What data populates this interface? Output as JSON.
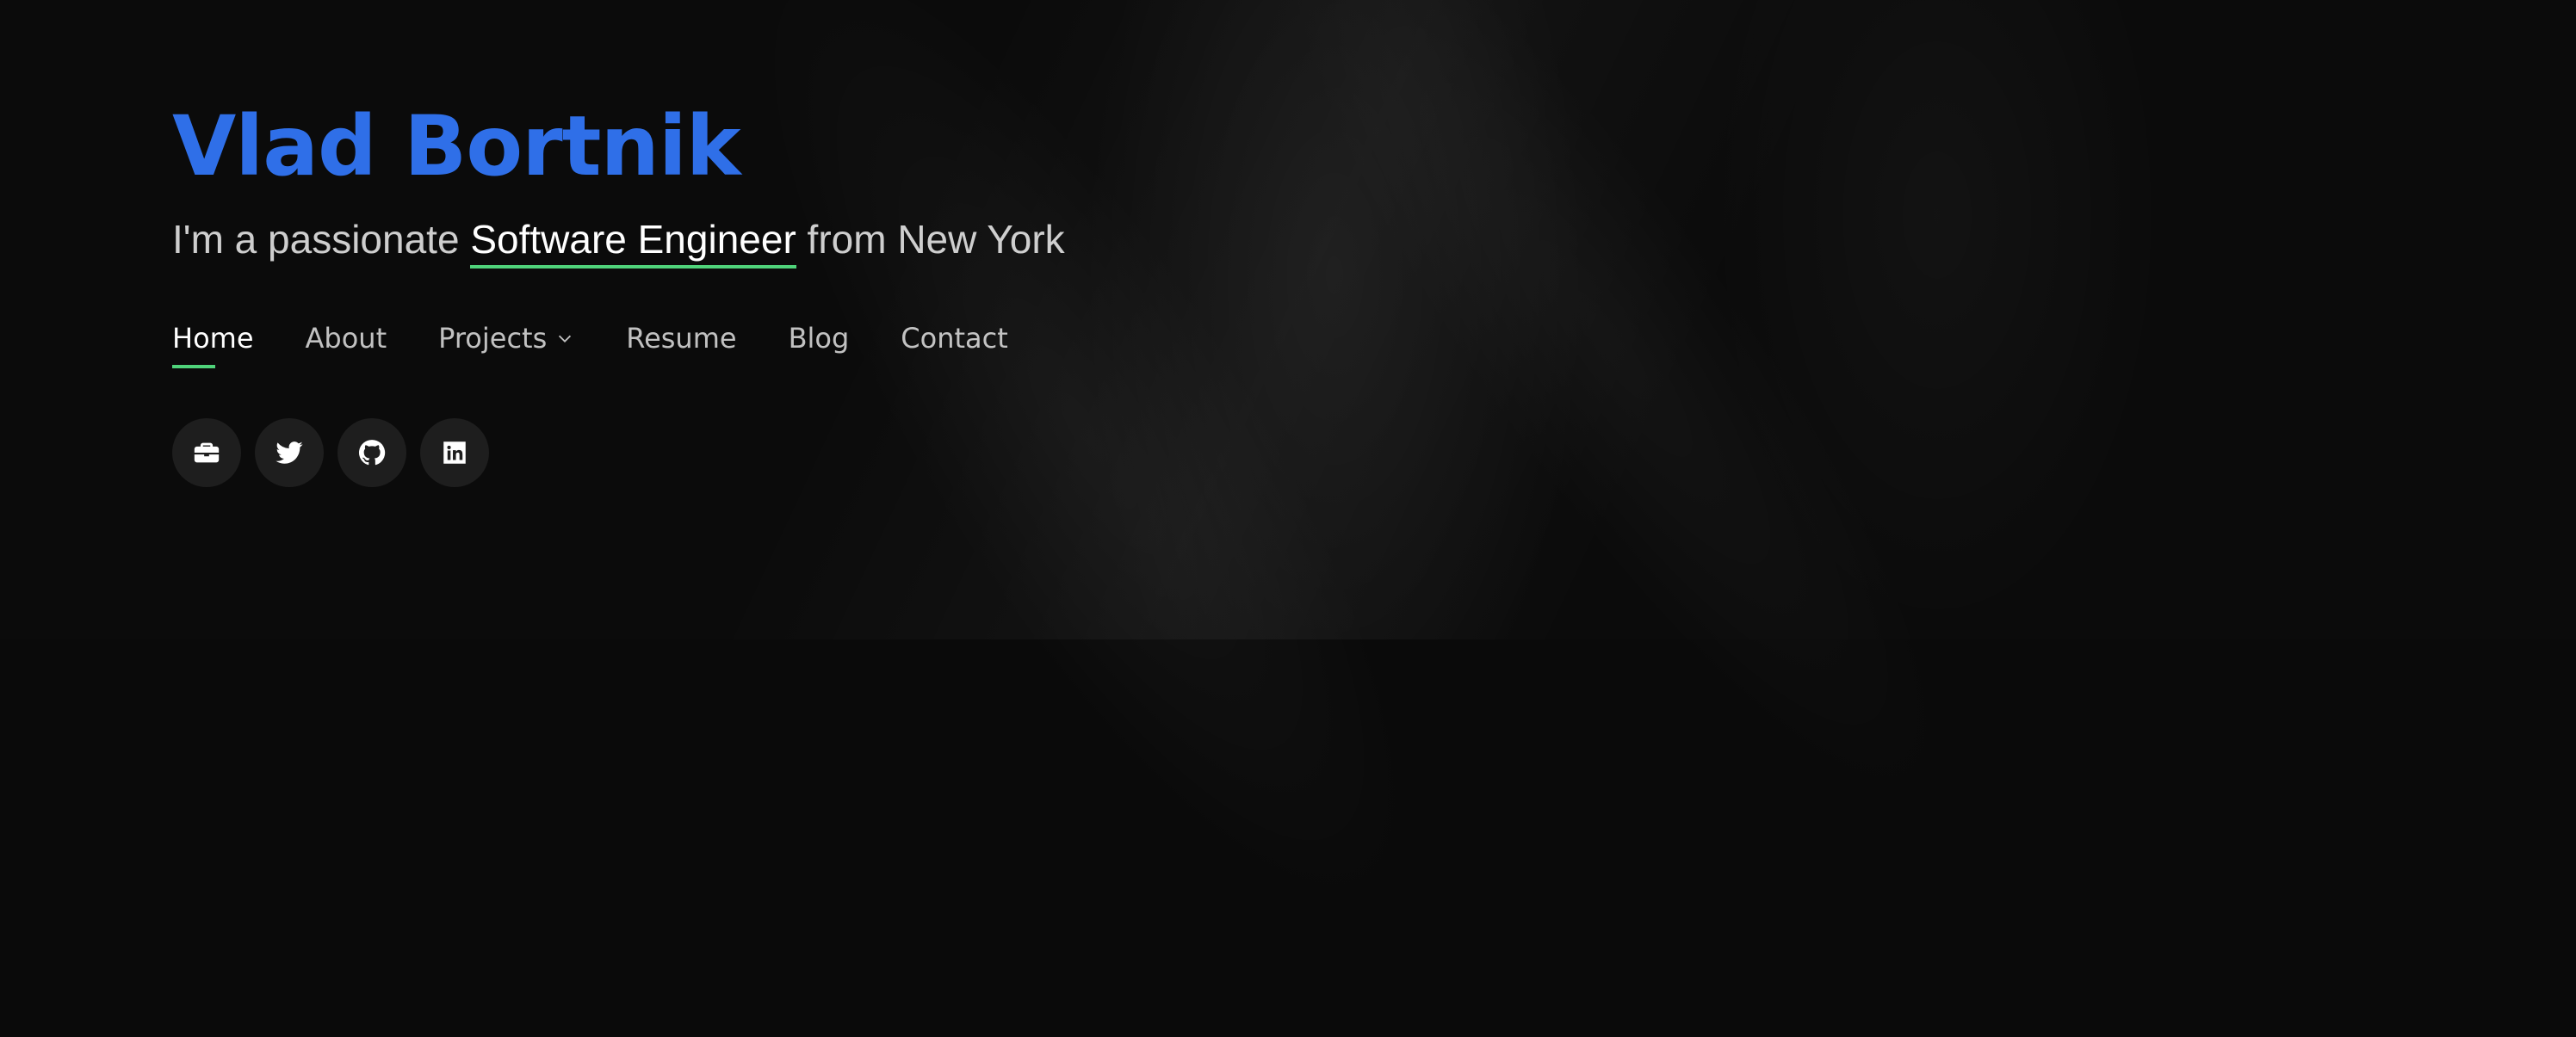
{
  "theme": {
    "accent_blue": "#2f6fe8",
    "accent_green": "#4fd37a",
    "background": "#0b0b0b"
  },
  "hero": {
    "title": "Vlad Bortnik",
    "tagline_prefix": "I'm a passionate",
    "tagline_highlight": "Software Engineer",
    "tagline_suffix": "from New York"
  },
  "nav": {
    "items": [
      {
        "label": "Home",
        "active": true
      },
      {
        "label": "About",
        "active": false
      },
      {
        "label": "Projects",
        "active": false,
        "icon": "chevron-down-icon"
      },
      {
        "label": "Resume",
        "active": false
      },
      {
        "label": "Blog",
        "active": false
      },
      {
        "label": "Contact",
        "active": false
      }
    ]
  },
  "social": {
    "icons": [
      "briefcase-icon",
      "twitter-icon",
      "github-icon",
      "linkedin-icon"
    ]
  }
}
